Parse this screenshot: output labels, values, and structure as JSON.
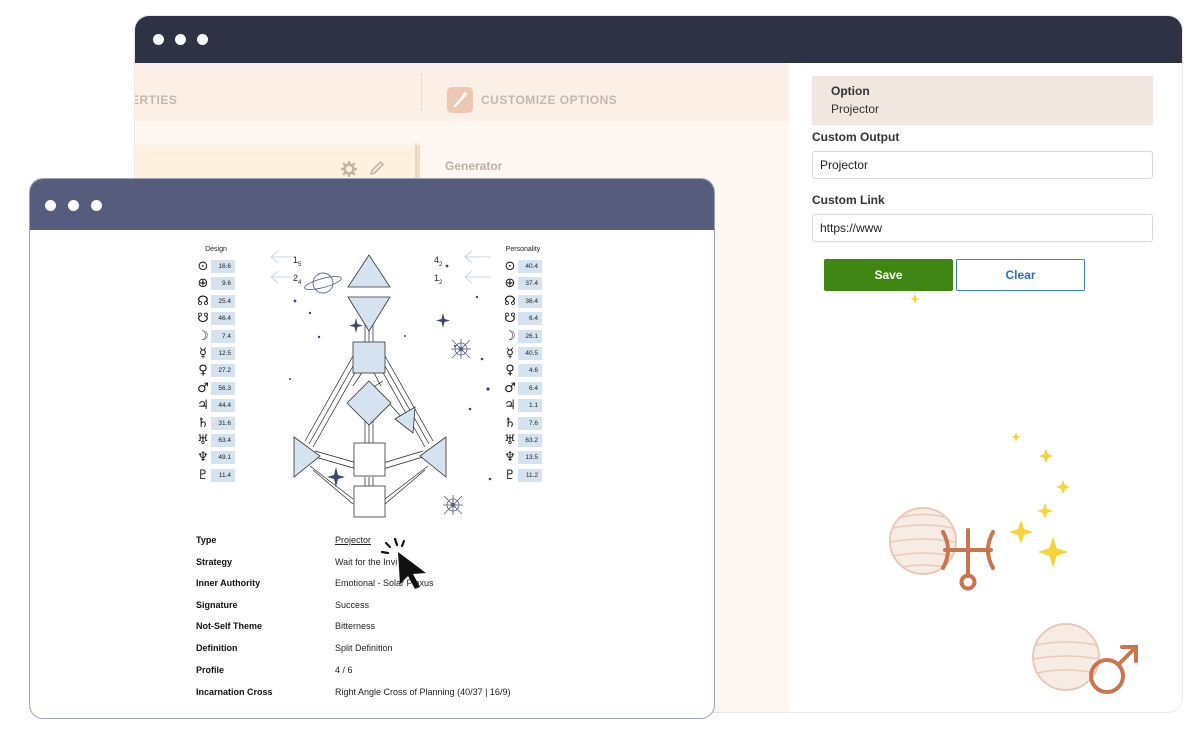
{
  "back_window": {
    "tabs": [
      {
        "label": "ERTIES"
      },
      {
        "label": "CUSTOMIZE OPTIONS"
      }
    ],
    "generator_label": "Generator",
    "option": {
      "title": "Option",
      "value": "Projector"
    },
    "custom_output": {
      "label": "Custom Output",
      "value": "Projector"
    },
    "custom_link": {
      "label": "Custom Link",
      "value": "https://www"
    },
    "buttons": {
      "save": "Save",
      "clear": "Clear"
    }
  },
  "chart": {
    "design_title": "Design",
    "personality_title": "Personality",
    "planets": [
      {
        "symbol": "⊙",
        "name": "sun",
        "design": "16.6",
        "personality": "40.4"
      },
      {
        "symbol": "⊕",
        "name": "earth",
        "design": "9.6",
        "personality": "37.4"
      },
      {
        "symbol": "☊",
        "name": "north-node",
        "design": "25.4",
        "personality": "36.4"
      },
      {
        "symbol": "☋",
        "name": "south-node",
        "design": "46.4",
        "personality": "6.4"
      },
      {
        "symbol": "☽",
        "name": "moon",
        "design": "7.4",
        "personality": "26.1"
      },
      {
        "symbol": "☿",
        "name": "mercury",
        "design": "12.5",
        "personality": "40.5"
      },
      {
        "symbol": "♀",
        "name": "venus",
        "design": "27.2",
        "personality": "4.6"
      },
      {
        "symbol": "♂",
        "name": "mars",
        "design": "56.3",
        "personality": "6.4"
      },
      {
        "symbol": "♃",
        "name": "jupiter",
        "design": "44.4",
        "personality": "1.1"
      },
      {
        "symbol": "♄",
        "name": "saturn",
        "design": "31.6",
        "personality": "7.6"
      },
      {
        "symbol": "♅",
        "name": "uranus",
        "design": "63.4",
        "personality": "63.2"
      },
      {
        "symbol": "♆",
        "name": "neptune",
        "design": "49.1",
        "personality": "13.5"
      },
      {
        "symbol": "♇",
        "name": "pluto",
        "design": "11.4",
        "personality": "11.2"
      }
    ],
    "arrows": {
      "left_top": "1",
      "left_top_sub": "5",
      "left_bottom": "2",
      "left_bottom_sub": "4",
      "right_top": "4",
      "right_top_sub": "2",
      "right_bottom": "1",
      "right_bottom_sub": "2"
    }
  },
  "details": [
    {
      "label": "Type",
      "value": "Projector"
    },
    {
      "label": "Strategy",
      "value": "Wait for the Invi"
    },
    {
      "label": "Inner Authority",
      "value": "Emotional - Solar Plexus"
    },
    {
      "label": "Signature",
      "value": "Success"
    },
    {
      "label": "Not-Self Theme",
      "value": "Bitterness"
    },
    {
      "label": "Definition",
      "value": "Split Definition"
    },
    {
      "label": "Profile",
      "value": "4 / 6"
    },
    {
      "label": "Incarnation Cross",
      "value": "Right Angle Cross of Planning (40/37 | 16/9)"
    }
  ],
  "colors": {
    "back_titlebar": "#2e3245",
    "front_titlebar": "#565c7d",
    "save_button": "#3e8611",
    "clear_button_border": "#3b7fd4",
    "center_fill": "#d5e2ef",
    "sparkle": "#f6d33a",
    "planet_deco": "#c9754f"
  },
  "decorations": {
    "uranus_icon": "uranus-icon",
    "mars_icon": "mars-icon",
    "sparkle_icon": "sparkle-icon"
  }
}
